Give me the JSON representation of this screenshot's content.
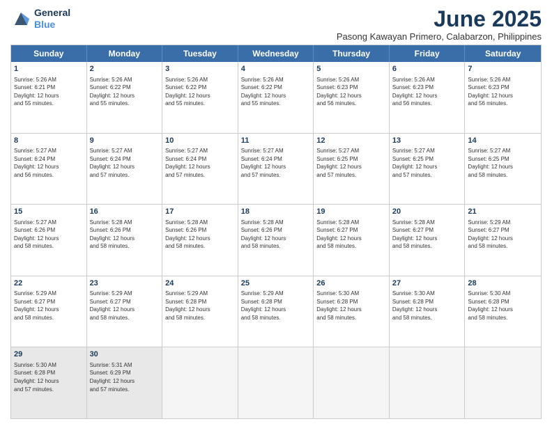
{
  "logo": {
    "line1": "General",
    "line2": "Blue"
  },
  "title": "June 2025",
  "location": "Pasong Kawayan Primero, Calabarzon, Philippines",
  "days": [
    "Sunday",
    "Monday",
    "Tuesday",
    "Wednesday",
    "Thursday",
    "Friday",
    "Saturday"
  ],
  "rows": [
    [
      {
        "day": "1",
        "lines": [
          "Sunrise: 5:26 AM",
          "Sunset: 6:21 PM",
          "Daylight: 12 hours",
          "and 55 minutes."
        ]
      },
      {
        "day": "2",
        "lines": [
          "Sunrise: 5:26 AM",
          "Sunset: 6:22 PM",
          "Daylight: 12 hours",
          "and 55 minutes."
        ]
      },
      {
        "day": "3",
        "lines": [
          "Sunrise: 5:26 AM",
          "Sunset: 6:22 PM",
          "Daylight: 12 hours",
          "and 55 minutes."
        ]
      },
      {
        "day": "4",
        "lines": [
          "Sunrise: 5:26 AM",
          "Sunset: 6:22 PM",
          "Daylight: 12 hours",
          "and 55 minutes."
        ]
      },
      {
        "day": "5",
        "lines": [
          "Sunrise: 5:26 AM",
          "Sunset: 6:23 PM",
          "Daylight: 12 hours",
          "and 56 minutes."
        ]
      },
      {
        "day": "6",
        "lines": [
          "Sunrise: 5:26 AM",
          "Sunset: 6:23 PM",
          "Daylight: 12 hours",
          "and 56 minutes."
        ]
      },
      {
        "day": "7",
        "lines": [
          "Sunrise: 5:26 AM",
          "Sunset: 6:23 PM",
          "Daylight: 12 hours",
          "and 56 minutes."
        ]
      }
    ],
    [
      {
        "day": "8",
        "lines": [
          "Sunrise: 5:27 AM",
          "Sunset: 6:24 PM",
          "Daylight: 12 hours",
          "and 56 minutes."
        ]
      },
      {
        "day": "9",
        "lines": [
          "Sunrise: 5:27 AM",
          "Sunset: 6:24 PM",
          "Daylight: 12 hours",
          "and 57 minutes."
        ]
      },
      {
        "day": "10",
        "lines": [
          "Sunrise: 5:27 AM",
          "Sunset: 6:24 PM",
          "Daylight: 12 hours",
          "and 57 minutes."
        ]
      },
      {
        "day": "11",
        "lines": [
          "Sunrise: 5:27 AM",
          "Sunset: 6:24 PM",
          "Daylight: 12 hours",
          "and 57 minutes."
        ]
      },
      {
        "day": "12",
        "lines": [
          "Sunrise: 5:27 AM",
          "Sunset: 6:25 PM",
          "Daylight: 12 hours",
          "and 57 minutes."
        ]
      },
      {
        "day": "13",
        "lines": [
          "Sunrise: 5:27 AM",
          "Sunset: 6:25 PM",
          "Daylight: 12 hours",
          "and 57 minutes."
        ]
      },
      {
        "day": "14",
        "lines": [
          "Sunrise: 5:27 AM",
          "Sunset: 6:25 PM",
          "Daylight: 12 hours",
          "and 58 minutes."
        ]
      }
    ],
    [
      {
        "day": "15",
        "lines": [
          "Sunrise: 5:27 AM",
          "Sunset: 6:26 PM",
          "Daylight: 12 hours",
          "and 58 minutes."
        ]
      },
      {
        "day": "16",
        "lines": [
          "Sunrise: 5:28 AM",
          "Sunset: 6:26 PM",
          "Daylight: 12 hours",
          "and 58 minutes."
        ]
      },
      {
        "day": "17",
        "lines": [
          "Sunrise: 5:28 AM",
          "Sunset: 6:26 PM",
          "Daylight: 12 hours",
          "and 58 minutes."
        ]
      },
      {
        "day": "18",
        "lines": [
          "Sunrise: 5:28 AM",
          "Sunset: 6:26 PM",
          "Daylight: 12 hours",
          "and 58 minutes."
        ]
      },
      {
        "day": "19",
        "lines": [
          "Sunrise: 5:28 AM",
          "Sunset: 6:27 PM",
          "Daylight: 12 hours",
          "and 58 minutes."
        ]
      },
      {
        "day": "20",
        "lines": [
          "Sunrise: 5:28 AM",
          "Sunset: 6:27 PM",
          "Daylight: 12 hours",
          "and 58 minutes."
        ]
      },
      {
        "day": "21",
        "lines": [
          "Sunrise: 5:29 AM",
          "Sunset: 6:27 PM",
          "Daylight: 12 hours",
          "and 58 minutes."
        ]
      }
    ],
    [
      {
        "day": "22",
        "lines": [
          "Sunrise: 5:29 AM",
          "Sunset: 6:27 PM",
          "Daylight: 12 hours",
          "and 58 minutes."
        ]
      },
      {
        "day": "23",
        "lines": [
          "Sunrise: 5:29 AM",
          "Sunset: 6:27 PM",
          "Daylight: 12 hours",
          "and 58 minutes."
        ]
      },
      {
        "day": "24",
        "lines": [
          "Sunrise: 5:29 AM",
          "Sunset: 6:28 PM",
          "Daylight: 12 hours",
          "and 58 minutes."
        ]
      },
      {
        "day": "25",
        "lines": [
          "Sunrise: 5:29 AM",
          "Sunset: 6:28 PM",
          "Daylight: 12 hours",
          "and 58 minutes."
        ]
      },
      {
        "day": "26",
        "lines": [
          "Sunrise: 5:30 AM",
          "Sunset: 6:28 PM",
          "Daylight: 12 hours",
          "and 58 minutes."
        ]
      },
      {
        "day": "27",
        "lines": [
          "Sunrise: 5:30 AM",
          "Sunset: 6:28 PM",
          "Daylight: 12 hours",
          "and 58 minutes."
        ]
      },
      {
        "day": "28",
        "lines": [
          "Sunrise: 5:30 AM",
          "Sunset: 6:28 PM",
          "Daylight: 12 hours",
          "and 58 minutes."
        ]
      }
    ],
    [
      {
        "day": "29",
        "lines": [
          "Sunrise: 5:30 AM",
          "Sunset: 6:28 PM",
          "Daylight: 12 hours",
          "and 57 minutes."
        ]
      },
      {
        "day": "30",
        "lines": [
          "Sunrise: 5:31 AM",
          "Sunset: 6:29 PM",
          "Daylight: 12 hours",
          "and 57 minutes."
        ]
      },
      {
        "day": "",
        "lines": [],
        "empty": true
      },
      {
        "day": "",
        "lines": [],
        "empty": true
      },
      {
        "day": "",
        "lines": [],
        "empty": true
      },
      {
        "day": "",
        "lines": [],
        "empty": true
      },
      {
        "day": "",
        "lines": [],
        "empty": true
      }
    ]
  ]
}
